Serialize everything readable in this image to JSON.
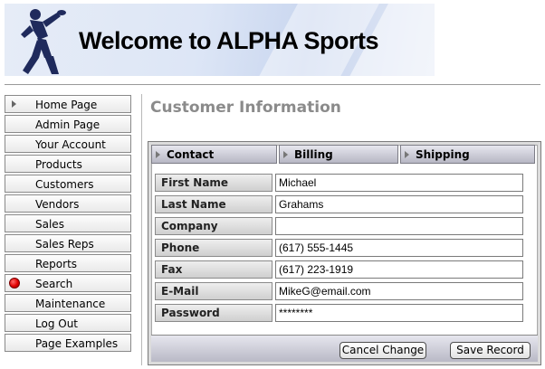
{
  "banner": {
    "title": "Welcome to ALPHA Sports",
    "logo_icon": "discus-thrower-icon"
  },
  "sidebar": {
    "items": [
      {
        "label": "Home Page",
        "marker": "triangle"
      },
      {
        "label": "Admin Page",
        "marker": "none"
      },
      {
        "label": "Your Account",
        "marker": "none"
      },
      {
        "label": "Products",
        "marker": "none"
      },
      {
        "label": "Customers",
        "marker": "none"
      },
      {
        "label": "Vendors",
        "marker": "none"
      },
      {
        "label": "Sales",
        "marker": "none"
      },
      {
        "label": "Sales Reps",
        "marker": "none"
      },
      {
        "label": "Reports",
        "marker": "none"
      },
      {
        "label": "Search",
        "marker": "red-dot"
      },
      {
        "label": "Maintenance",
        "marker": "none"
      },
      {
        "label": "Log Out",
        "marker": "none"
      },
      {
        "label": "Page Examples",
        "marker": "none"
      }
    ]
  },
  "main": {
    "title": "Customer Information",
    "tabs": [
      {
        "label": "Contact"
      },
      {
        "label": "Billing"
      },
      {
        "label": "Shipping"
      }
    ],
    "fields": [
      {
        "label": "First Name",
        "value": "Michael"
      },
      {
        "label": "Last Name",
        "value": "Grahams"
      },
      {
        "label": "Company",
        "value": ""
      },
      {
        "label": "Phone",
        "value": "(617) 555-1445"
      },
      {
        "label": "Fax",
        "value": "(617) 223-1919"
      },
      {
        "label": "E-Mail",
        "value": "MikeG@email.com"
      },
      {
        "label": "Password",
        "value": "********"
      }
    ],
    "buttons": {
      "cancel": "Cancel Change",
      "save": "Save Record"
    }
  },
  "colors": {
    "title_gray": "#8b8b8b",
    "search_dot": "#e00000",
    "tab_gradient_bottom": "#b7b7c4"
  }
}
